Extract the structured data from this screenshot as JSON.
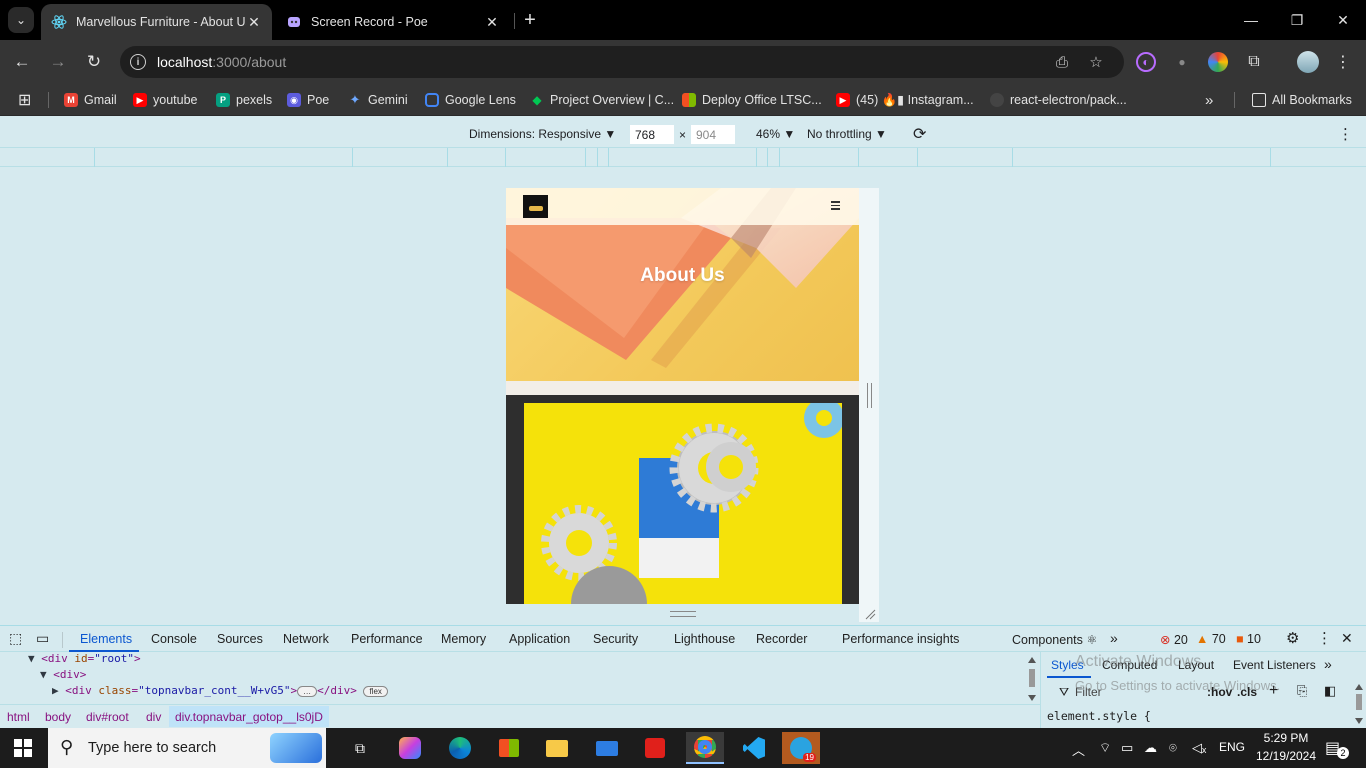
{
  "browser": {
    "tabs": [
      {
        "title": "Marvellous Furniture - About Us",
        "active": true,
        "icon": "react-icon"
      },
      {
        "title": "Screen Record - Poe",
        "active": false,
        "icon": "poe-icon"
      }
    ],
    "url_host": "localhost",
    "url_path": ":3000/about",
    "bookmarks": [
      {
        "label": "Gmail",
        "icon": "gmail-icon",
        "color": "#ea4335"
      },
      {
        "label": "youtube",
        "icon": "youtube-icon",
        "color": "#ff0000"
      },
      {
        "label": "pexels",
        "icon": "pexels-icon",
        "color": "#05a081"
      },
      {
        "label": "Poe",
        "icon": "poe-icon",
        "color": "#5d5cde"
      },
      {
        "label": "Gemini",
        "icon": "gemini-icon",
        "color": "#4f8df7"
      },
      {
        "label": "Google Lens",
        "icon": "google-lens-icon",
        "color": "#4285f4"
      },
      {
        "label": "Project Overview | C...",
        "icon": "project-icon",
        "color": "#00c853"
      },
      {
        "label": "Deploy Office LTSC...",
        "icon": "microsoft-icon",
        "color": "#f25022"
      },
      {
        "label": "(45) 🔥▮ Instagram...",
        "icon": "youtube-icon",
        "color": "#ff0000"
      },
      {
        "label": "react-electron/pack...",
        "icon": "github-icon",
        "color": "#6e6e6e"
      }
    ],
    "all_bookmarks": "All Bookmarks"
  },
  "device_toolbar": {
    "dimensions_label": "Dimensions: Responsive",
    "width": "768",
    "times": "×",
    "height": "904",
    "zoom": "46%",
    "throttling": "No throttling"
  },
  "page": {
    "hero_title": "About Us"
  },
  "devtools": {
    "tabs": [
      "Elements",
      "Console",
      "Sources",
      "Network",
      "Performance",
      "Memory",
      "Application",
      "Security",
      "Lighthouse",
      "Recorder",
      "Performance insights",
      "Components ⚛"
    ],
    "errors": "20",
    "warnings": "70",
    "issues": "10",
    "dom_lines": [
      {
        "open": "<div ",
        "attr": "id",
        "val": "\"root\"",
        "close": ">"
      },
      {
        "open": "<div>"
      },
      {
        "open": "<div ",
        "attr": "class",
        "val": "\"topnavbar_cont__W+vG5\"",
        "close": ">",
        "ellipsis": "…",
        "end": "</div>",
        "pill": "flex"
      }
    ],
    "breadcrumbs": [
      "html",
      "body",
      "div#root",
      "div",
      "div.topnavbar_gotop__ls0jD"
    ],
    "styles_tabs": [
      "Styles",
      "Computed",
      "Layout",
      "Event Listeners"
    ],
    "filter_placeholder": "Filter",
    "hov": ":hov",
    "cls": ".cls",
    "element_style": "element.style {",
    "watermark_title": "Activate Windows",
    "watermark_sub": "Go to Settings to activate Windows."
  },
  "taskbar": {
    "search_placeholder": "Type here to search",
    "language": "ENG",
    "time": "5:29 PM",
    "date": "12/19/2024",
    "notifications": "2",
    "telegram_badge": "19"
  }
}
